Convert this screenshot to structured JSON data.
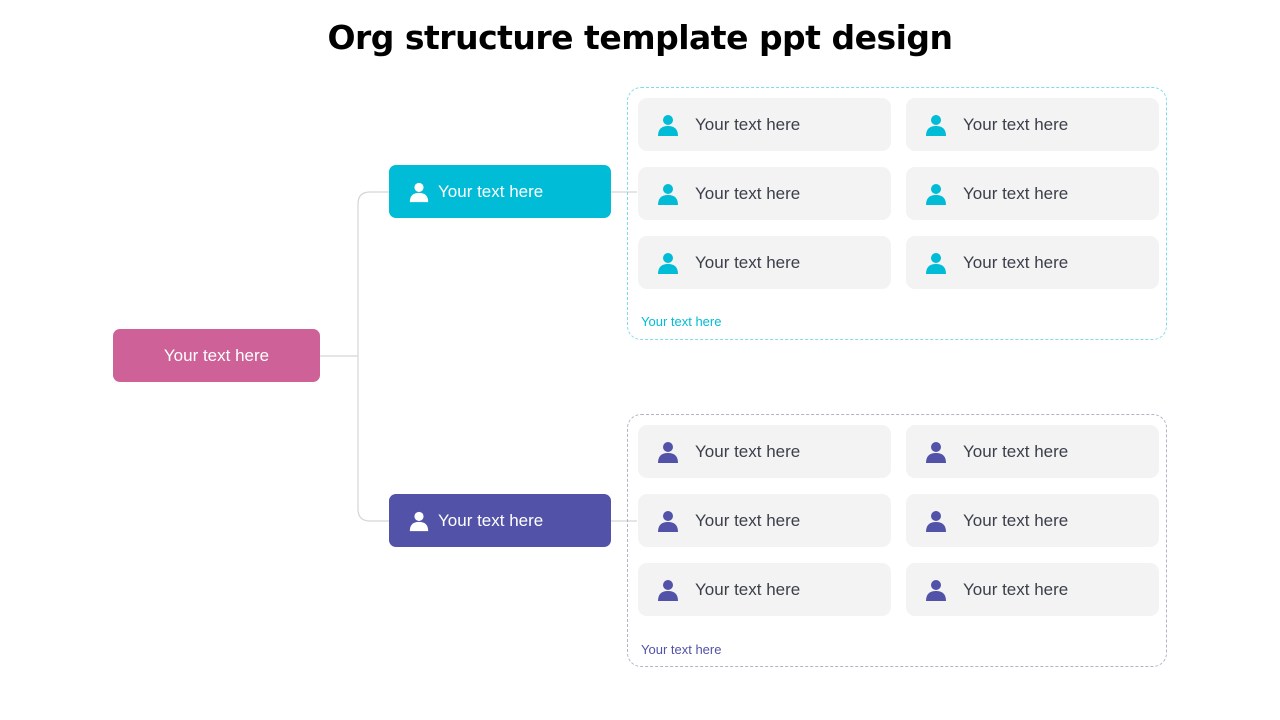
{
  "title": "Org structure template ppt design",
  "colors": {
    "root": "#cd6198",
    "branch_top": "#00bcd6",
    "branch_bottom": "#5152a8",
    "card_bg": "#f3f3f3",
    "card_text": "#3b3f4a",
    "connector": "#d5d5d5"
  },
  "root": {
    "label": "Your text here"
  },
  "branches": [
    {
      "label": "Your text here",
      "icon": "person-icon",
      "caption": "Your text here",
      "members": [
        {
          "label": "Your text here",
          "icon": "person-icon"
        },
        {
          "label": "Your text here",
          "icon": "person-icon"
        },
        {
          "label": "Your text here",
          "icon": "person-icon"
        },
        {
          "label": "Your text here",
          "icon": "person-icon"
        },
        {
          "label": "Your text here",
          "icon": "person-icon"
        },
        {
          "label": "Your text here",
          "icon": "person-icon"
        }
      ]
    },
    {
      "label": "Your text here",
      "icon": "person-icon",
      "caption": "Your text here",
      "members": [
        {
          "label": "Your text here",
          "icon": "person-icon"
        },
        {
          "label": "Your text here",
          "icon": "person-icon"
        },
        {
          "label": "Your text here",
          "icon": "person-icon"
        },
        {
          "label": "Your text here",
          "icon": "person-icon"
        },
        {
          "label": "Your text here",
          "icon": "person-icon"
        },
        {
          "label": "Your text here",
          "icon": "person-icon"
        }
      ]
    }
  ]
}
